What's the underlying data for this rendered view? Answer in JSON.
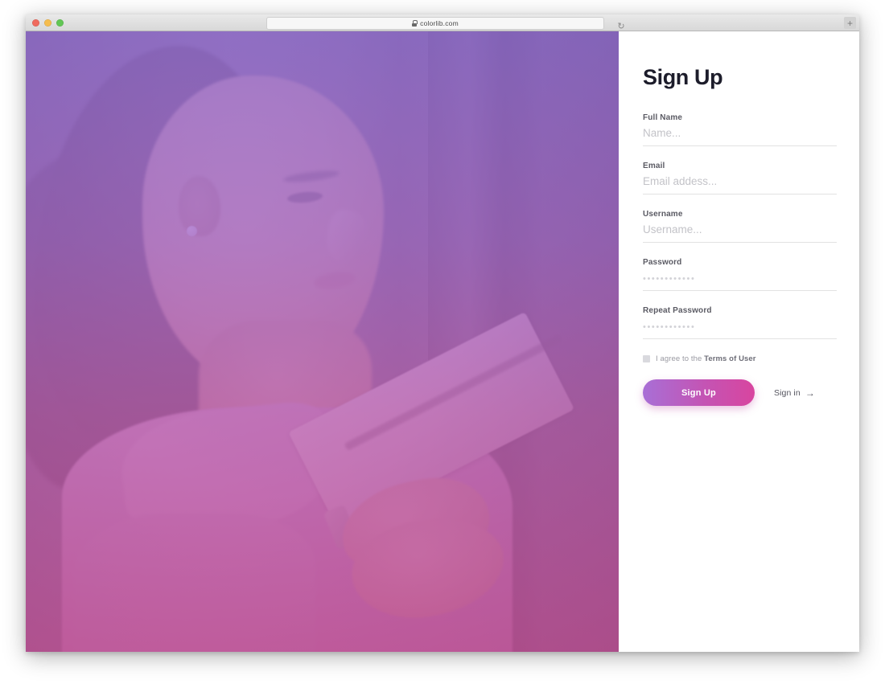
{
  "browser": {
    "url": "colorlib.com",
    "lock_icon": "lock-icon",
    "reload_icon": "reload-icon",
    "reload_glyph": "↻",
    "newtab_icon": "plus-icon",
    "newtab_glyph": "+",
    "traffic_lights": [
      "close-red",
      "minimize-yellow",
      "maximize-green"
    ]
  },
  "hero": {
    "alt": "woman in profile holding a tablet",
    "overlay_top_color": "#9670d6",
    "overlay_bottom_color": "#c6549c"
  },
  "form": {
    "title": "Sign Up",
    "fields": [
      {
        "label": "Full Name",
        "placeholder": "Name...",
        "value": "",
        "type": "text",
        "name": "fullname"
      },
      {
        "label": "Email",
        "placeholder": "Email addess...",
        "value": "",
        "type": "text",
        "name": "email"
      },
      {
        "label": "Username",
        "placeholder": "Username...",
        "value": "",
        "type": "text",
        "name": "username"
      },
      {
        "label": "Password",
        "placeholder": "••••••••••••",
        "value": "",
        "type": "password",
        "name": "password"
      },
      {
        "label": "Repeat Password",
        "placeholder": "••••••••••••",
        "value": "",
        "type": "password",
        "name": "repeat-password"
      }
    ],
    "agree": {
      "checked": false,
      "text_before": "I agree to the ",
      "terms_label": "Terms of User"
    },
    "submit_label": "Sign Up",
    "signin_label": "Sign in",
    "signin_arrow": "→",
    "button_gradient_start": "#a86fd6",
    "button_gradient_end": "#d8459f"
  }
}
